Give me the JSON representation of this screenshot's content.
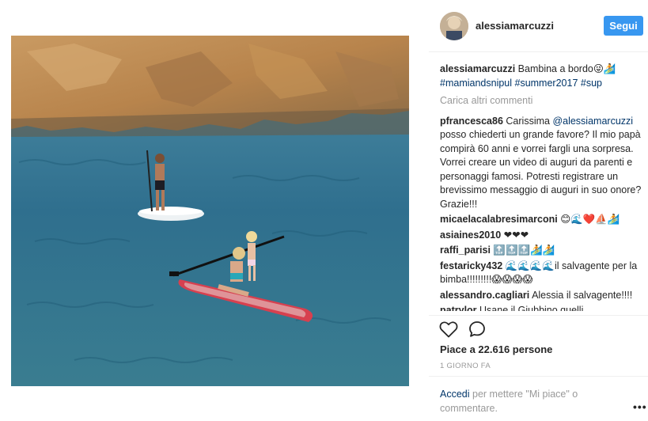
{
  "photo": {
    "alt": "Bambina a bordo"
  },
  "header": {
    "username": "alessiamarcuzzi",
    "follow_label": "Segui"
  },
  "caption": {
    "user": "alessiamarcuzzi",
    "text": " Bambina a bordo😜🏄",
    "hashtags": "#mamiandsnipul #summer2017 #sup"
  },
  "load_more": "Carica altri commenti",
  "comments": [
    {
      "user": "pfrancesca86",
      "pre": " Carissima ",
      "mention": "@alessiamarcuzzi",
      "text": " posso chiederti un grande favore? Il mio papà compirà 60 anni e vorrei fargli una sorpresa. Vorrei creare un video di auguri da parenti e personaggi famosi. Potresti registrare un brevissimo messaggio di auguri in suo onore? Grazie!!!"
    },
    {
      "user": "micaelacalabresimarconi",
      "pre": " ",
      "mention": "",
      "text": "😊🌊❤️⛵🏄"
    },
    {
      "user": "asiaines2010",
      "pre": " ",
      "mention": "",
      "text": "❤❤❤"
    },
    {
      "user": "raffi_parisi",
      "pre": " ",
      "mention": "",
      "text": "🔝🔝🔝🏄🏄"
    },
    {
      "user": "festaricky432",
      "pre": " ",
      "mention": "",
      "text": "🌊🌊🌊🌊il salvagente per la bimba!!!!!!!!!😱😱😱😱"
    },
    {
      "user": "alessandro.cagliari",
      "pre": " ",
      "mention": "",
      "text": "Alessia il salvagente!!!!"
    },
    {
      "user": "patrylor",
      "pre": " ",
      "mention": "",
      "text": "Usane il Giubbino quelli"
    }
  ],
  "likes": "Piace a 22.616 persone",
  "timestamp": "1 GIORNO FA",
  "login": {
    "link": "Accedi",
    "text": " per mettere \"Mi piace\" o commentare."
  },
  "more_label": "•••",
  "icons": {
    "heart": "heart-icon",
    "comment": "comment-bubble-icon",
    "more": "more-options-icon"
  }
}
